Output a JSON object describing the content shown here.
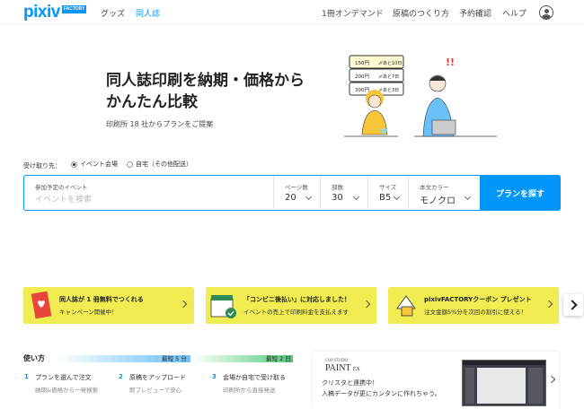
{
  "header": {
    "logo": "pixiv",
    "logo_badge": "FACTORY",
    "nav": [
      {
        "label": "グッズ",
        "active": false
      },
      {
        "label": "同人誌",
        "active": true
      }
    ],
    "right_nav": [
      "1冊オンデマンド",
      "原稿のつくり方",
      "予約確認",
      "ヘルプ"
    ]
  },
  "hero": {
    "title_line1": "同人誌印刷を納期・価格から",
    "title_line2": "かんたん比較",
    "subtitle": "印刷所 18 社からプランをご提案",
    "illustration_labels": {
      "prices": [
        "150円",
        "200円",
        "300円"
      ],
      "days": [
        "〆あと10日",
        "〆あと7日",
        "〆あと3日"
      ],
      "exclaim": "!!"
    }
  },
  "search": {
    "receive_label": "受け取り先：",
    "options": [
      {
        "label": "イベント会場",
        "selected": true
      },
      {
        "label": "自宅（その他配送）",
        "selected": false
      }
    ],
    "event": {
      "label": "参加予定のイベント",
      "placeholder": "イベントを検索"
    },
    "pages": {
      "label": "ページ数",
      "value": "20"
    },
    "copies": {
      "label": "部数",
      "value": "30"
    },
    "size": {
      "label": "サイズ",
      "value": "B5"
    },
    "color": {
      "label": "本文カラー",
      "value": "モノクロ"
    },
    "button": "プランを探す"
  },
  "banners": [
    {
      "title": "同人誌が 1 冊無料でつくれる",
      "sub": "キャンペーン開催中！"
    },
    {
      "title": "「コンビニ後払い」に対応しました！",
      "sub": "イベントの売上で印刷料金を支払えます"
    },
    {
      "title": "pixivFACTORYクーポン プレゼント",
      "sub": "注文金額5%分を次回の割引に使える！"
    }
  ],
  "howto": {
    "title": "使い方",
    "fastest": "最短 5 分",
    "days": "最短 2 日",
    "steps": [
      {
        "n": "1",
        "title": "プランを選んで注文",
        "sub": "納期&価格から一発検索"
      },
      {
        "n": "2",
        "title": "原稿をアップロード",
        "sub": "即プレビューで安心"
      },
      {
        "n": "3",
        "title": "会場か自宅で受け取る",
        "sub": "印刷所から直接発送"
      }
    ]
  },
  "clip": {
    "brand": "CLIP STUDIO",
    "logo": "PAINT",
    "logo_suffix": "EX",
    "line1": "クリスタと連携中！",
    "line2": "入稿データが更にカンタンに作れちゃう。"
  },
  "colors": {
    "brand": "#0096fa",
    "banner": "#f2ec53",
    "green": "#4cc97a"
  }
}
